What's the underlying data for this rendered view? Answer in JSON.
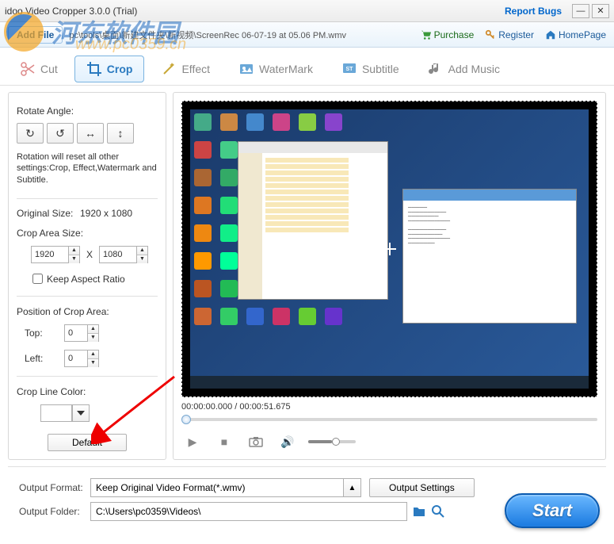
{
  "watermark": {
    "text": "河东软件园",
    "sub": "www.pc0359.cn"
  },
  "titlebar": {
    "title": "idoo Video Cropper 3.0.0 (Trial)",
    "report": "Report Bugs"
  },
  "topbar": {
    "addfile": "Add File",
    "filepath": "pc\\tools\\桌面\\新建文件夹\\新视频\\ScreenRec 06-07-19 at 05.06 PM.wmv",
    "purchase": "Purchase",
    "register": "Register",
    "homepage": "HomePage"
  },
  "tabs": [
    "Cut",
    "Crop",
    "Effect",
    "WaterMark",
    "Subtitle",
    "Add Music"
  ],
  "active_tab": 1,
  "sidebar": {
    "rotate_label": "Rotate Angle:",
    "note": "Rotation will reset all other settings:Crop, Effect,Watermark and Subtitle.",
    "original_size_label": "Original Size:",
    "original_size": "1920 x 1080",
    "crop_area_label": "Crop Area Size:",
    "width": "1920",
    "height": "1080",
    "x_sep": "X",
    "keep_aspect": "Keep Aspect Ratio",
    "position_label": "Position of Crop Area:",
    "top_label": "Top:",
    "top": "0",
    "left_label": "Left:",
    "left": "0",
    "crop_color_label": "Crop Line Color:",
    "default_btn": "Default"
  },
  "preview": {
    "timecode": "00:00:00.000 / 00:00:51.675"
  },
  "bottom": {
    "format_label": "Output Format:",
    "format": "Keep Original Video Format(*.wmv)",
    "output_settings": "Output Settings",
    "folder_label": "Output Folder:",
    "folder": "C:\\Users\\pc0359\\Videos\\",
    "start": "Start"
  }
}
